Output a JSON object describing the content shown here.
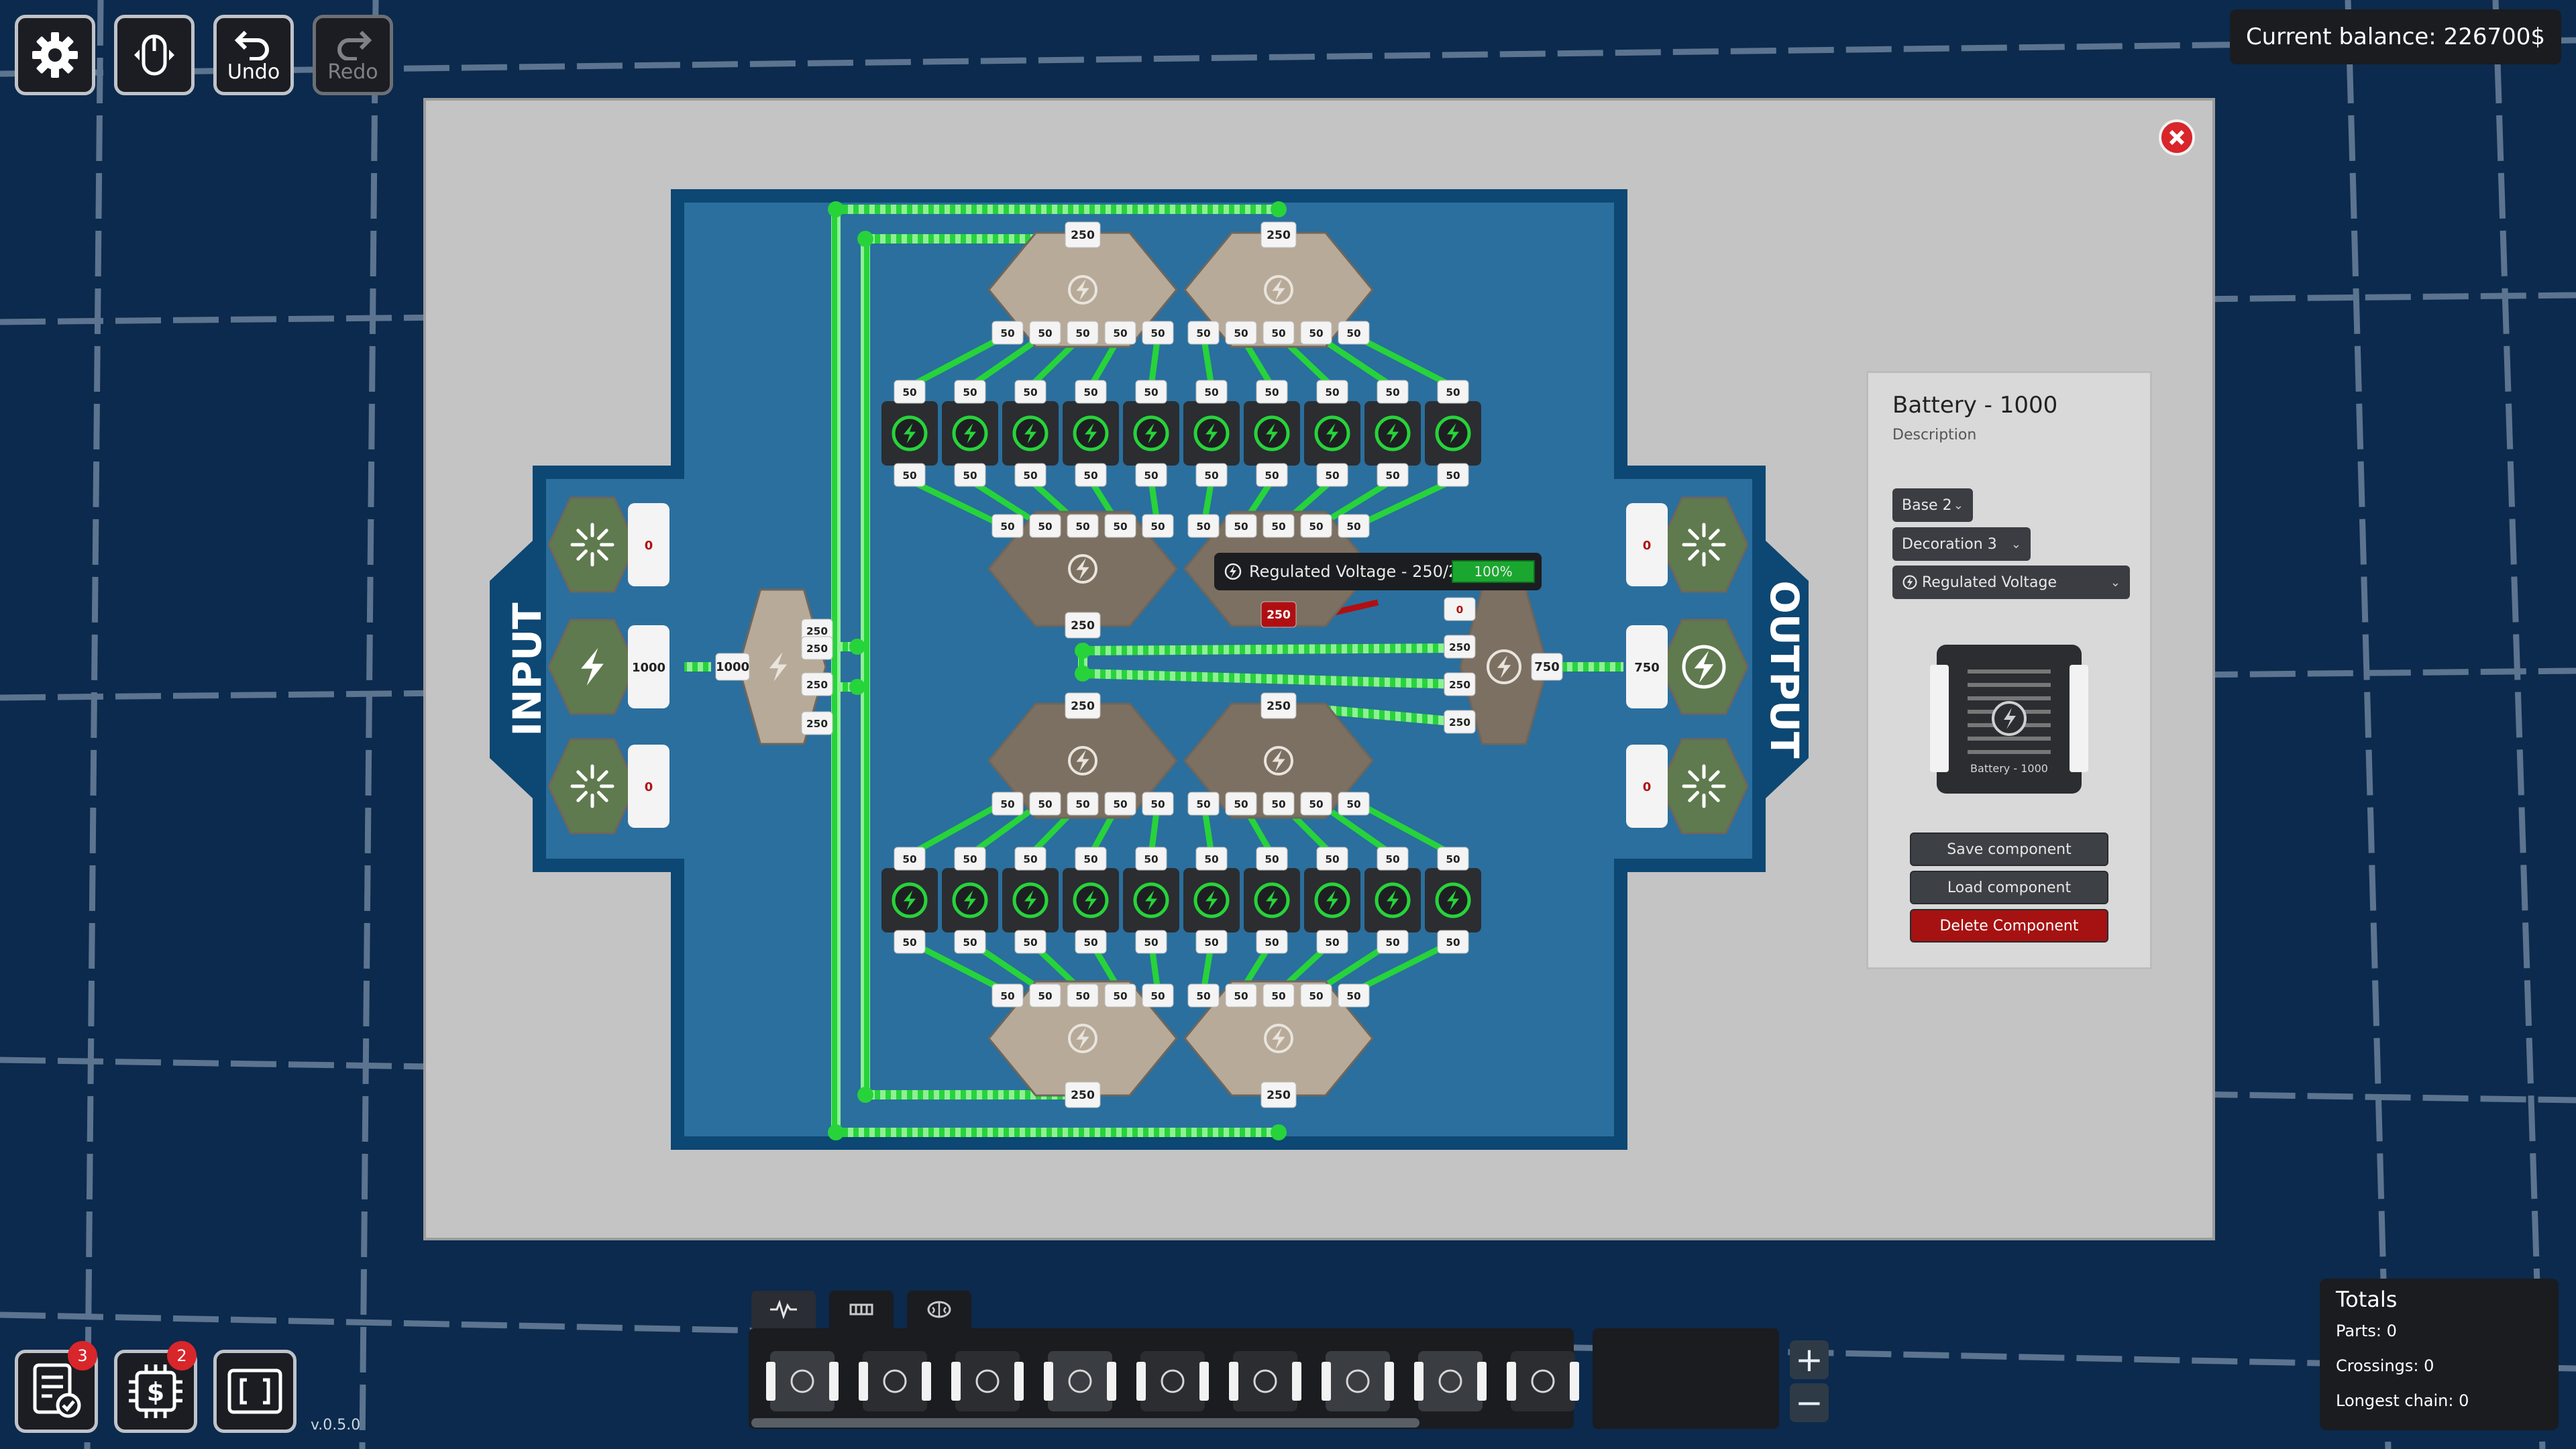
{
  "toolbar": {
    "settings_icon": "gear-icon",
    "mouse_icon": "mouse-icon",
    "undo_label": "Undo",
    "redo_label": "Redo"
  },
  "balance": {
    "text": "Current balance: 226700$"
  },
  "editor": {
    "input_label": "INPUT",
    "output_label": "OUTPUT",
    "input_values": [
      "0",
      "1000",
      "0"
    ],
    "output_values": [
      "0",
      "750",
      "0"
    ],
    "splitter_in": "1000",
    "splitter_outs": [
      "250",
      "250",
      "250",
      "250"
    ],
    "hub_top_values": [
      "250",
      "250"
    ],
    "hub_bottom_values": [
      "250",
      "250"
    ],
    "small_value": "50",
    "regulator_inputs": [
      "0",
      "250",
      "250",
      "250"
    ],
    "regulator_output": "750",
    "fault_value": "250",
    "tooltip": {
      "text": "Regulated Voltage - 250/250",
      "percent": "100%",
      "percent_value": 1.0
    }
  },
  "inspector": {
    "title": "Battery - 1000",
    "description": "Description",
    "base": "Base 2",
    "decoration": "Decoration 3",
    "mode": "Regulated Voltage",
    "preview_label": "Battery - 1000",
    "save_label": "Save component",
    "load_label": "Load component",
    "delete_label": "Delete Component"
  },
  "bottom": {
    "badges": [
      "3",
      "2"
    ],
    "version": "v.0.5.0"
  },
  "palette": {
    "tabs": [
      "waveform-icon",
      "chip-icon",
      "brain-icon"
    ]
  },
  "totals": {
    "title": "Totals",
    "parts": "Parts: 0",
    "crossings": "Crossings: 0",
    "longest": "Longest chain: 0"
  },
  "colors": {
    "wire": "#27d33a",
    "board": "#2a6f9e",
    "board_border": "#0d4773",
    "danger": "#a61212",
    "accent": "#1aa72f"
  }
}
